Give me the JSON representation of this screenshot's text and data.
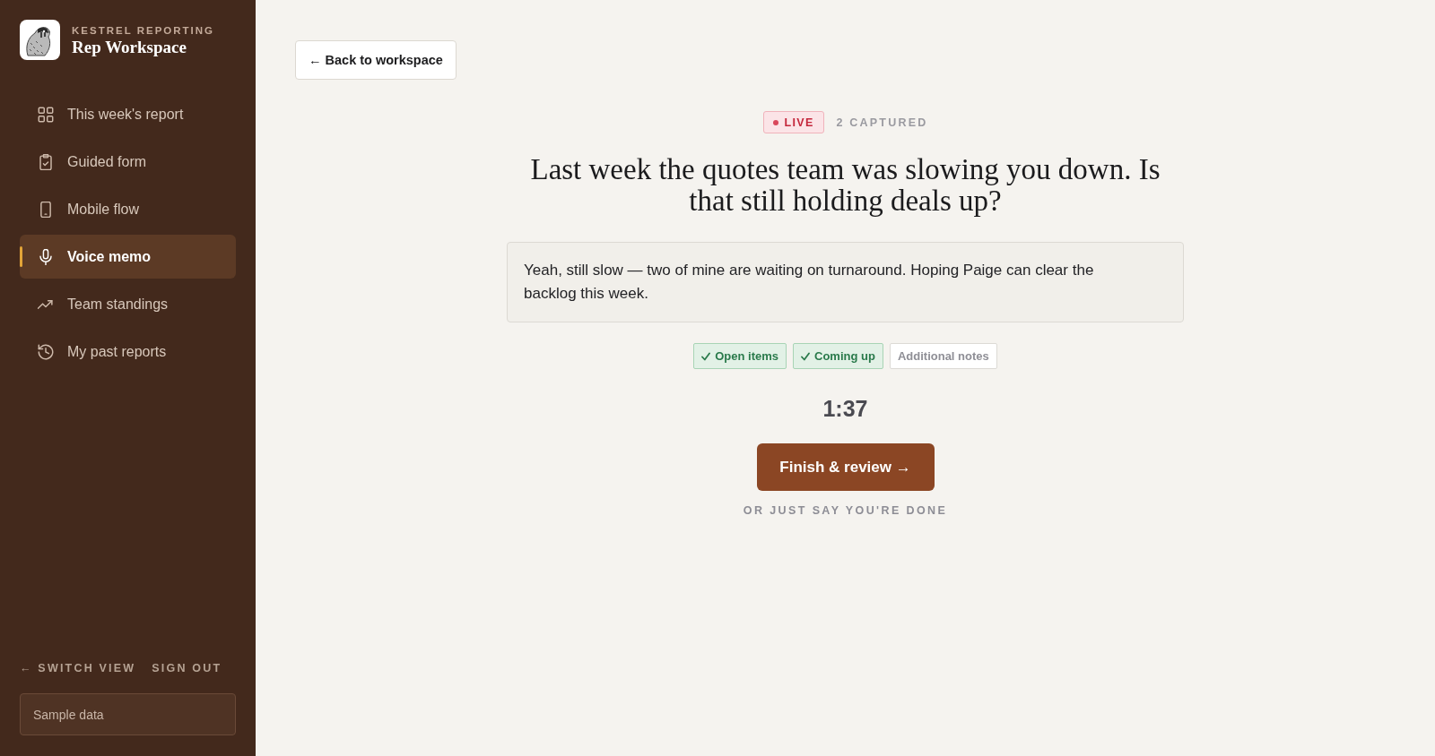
{
  "sidebar": {
    "brand": {
      "eyebrow": "KESTREL REPORTING",
      "title": "Rep Workspace"
    },
    "nav": [
      {
        "label": "This week's report",
        "selected": false
      },
      {
        "label": "Guided form",
        "selected": false
      },
      {
        "label": "Mobile flow",
        "selected": false
      },
      {
        "label": "Voice memo",
        "selected": true
      },
      {
        "label": "Team standings",
        "selected": false
      },
      {
        "label": "My past reports",
        "selected": false
      }
    ],
    "footer_links": [
      "← SWITCH VIEW",
      "SIGN OUT"
    ],
    "data_source": {
      "value": "Sample data"
    }
  },
  "main": {
    "back_button": {
      "label": "← Back to workspace"
    },
    "status": {
      "live_badge": "LIVE",
      "captured": "2 CAPTURED"
    },
    "question": "Last week the quotes team was slowing you down. Is that still holding deals up?",
    "transcript": "Yeah, still slow — two of mine are waiting on turnaround. Hoping Paige can clear the backlog this week.",
    "sections": [
      {
        "label": "Open items",
        "checked": true
      },
      {
        "label": "Coming up",
        "checked": true
      },
      {
        "label": "Additional notes",
        "checked": false
      }
    ],
    "timer": "1:37",
    "finish_button": {
      "label": "Finish & review →"
    },
    "hint": "OR JUST SAY YOU'RE DONE"
  }
}
